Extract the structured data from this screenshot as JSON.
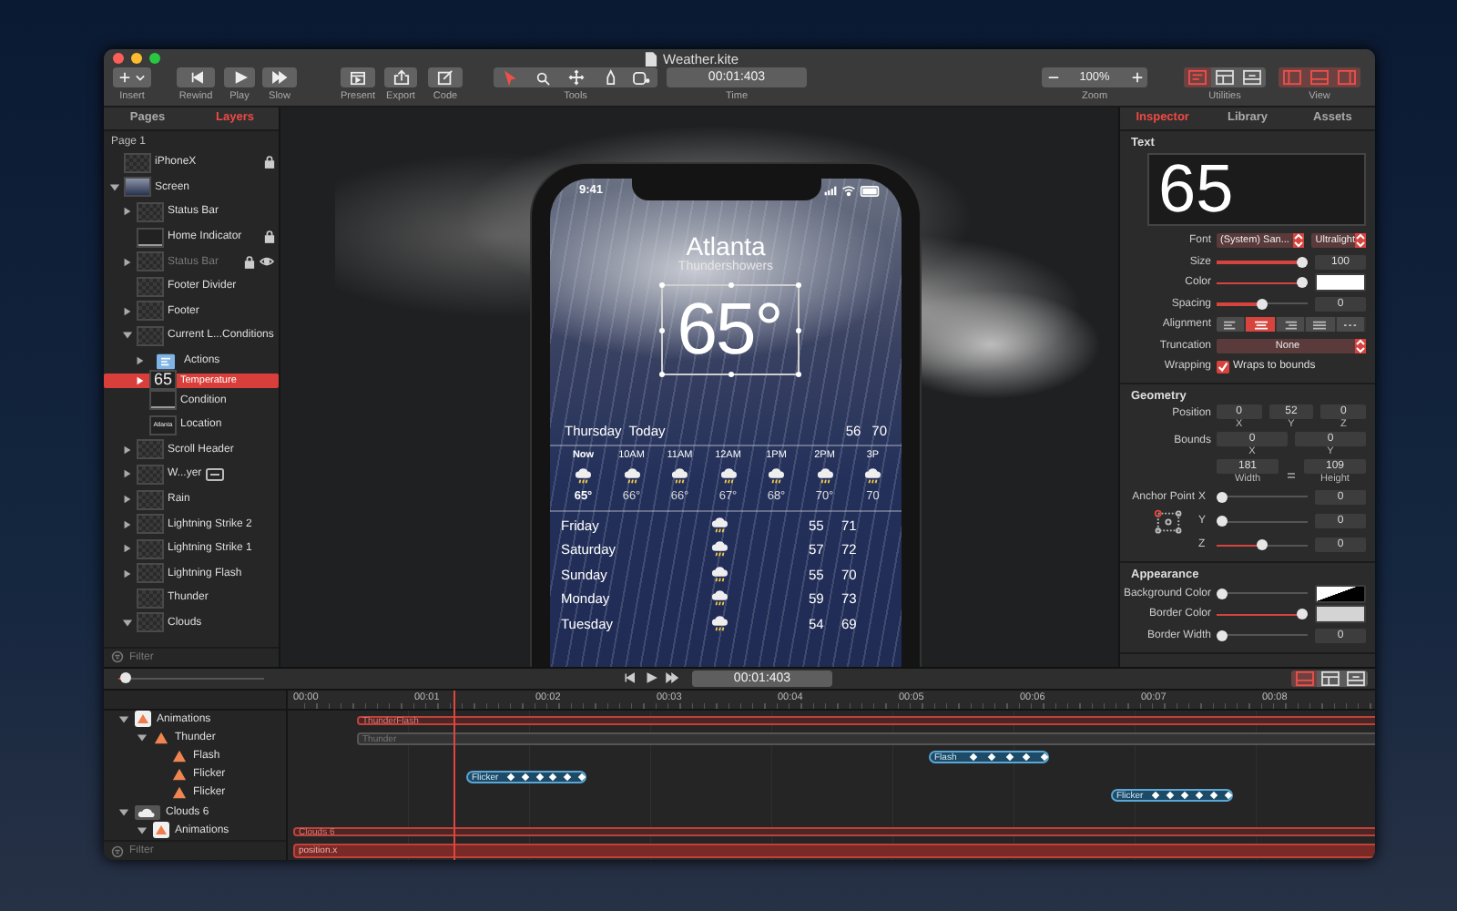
{
  "window": {
    "title": "Weather.kite"
  },
  "toolbar": [
    {
      "kind": "insert",
      "label": "Insert"
    },
    {
      "kind": "rewind",
      "label": "Rewind"
    },
    {
      "kind": "play",
      "label": "Play"
    },
    {
      "kind": "slow",
      "label": "Slow"
    },
    {
      "kind": "present",
      "label": "Present"
    },
    {
      "kind": "export",
      "label": "Export"
    },
    {
      "kind": "code",
      "label": "Code"
    },
    {
      "kind": "tools",
      "label": "Tools",
      "tools": [
        {
          "kind": "pointer",
          "selected": true
        },
        {
          "kind": "zoom",
          "selected": false
        },
        {
          "kind": "move",
          "selected": false
        },
        {
          "kind": "pen",
          "selected": false
        },
        {
          "kind": "shape",
          "selected": false
        }
      ]
    },
    {
      "kind": "time",
      "label": "Time",
      "value": "00:01:403"
    },
    {
      "kind": "zoom",
      "label": "Zoom",
      "value": "100%"
    },
    {
      "kind": "panes",
      "label": "Utilities",
      "panes": [
        {
          "kind": "inspector",
          "on": true
        },
        {
          "kind": "library",
          "on": false
        },
        {
          "kind": "assets",
          "on": false
        }
      ]
    },
    {
      "kind": "panes",
      "label": "View",
      "panes": [
        {
          "kind": "left",
          "on": true
        },
        {
          "kind": "bottom",
          "on": true
        },
        {
          "kind": "right",
          "on": true
        }
      ]
    }
  ],
  "layers_panel": {
    "tabs": [
      {
        "label": "Pages",
        "selected": false
      },
      {
        "label": "Layers",
        "selected": true
      }
    ],
    "page": "Page 1",
    "layers": [
      {
        "name": "iPhoneX",
        "locked": true,
        "hidden": false,
        "selected": false
      },
      {
        "name": "Screen",
        "expanded": true,
        "locked": false,
        "hidden": false,
        "selected": false,
        "children": [
          {
            "name": "Status Bar",
            "expanded": false,
            "locked": false,
            "hidden": false,
            "selected": false
          },
          {
            "name": "Home Indicator",
            "locked": true,
            "hidden": false,
            "selected": false
          },
          {
            "name": "Status Bar",
            "expanded": false,
            "locked": true,
            "hidden": true,
            "selected": false
          },
          {
            "name": "Footer Divider",
            "locked": false,
            "hidden": false,
            "selected": false
          },
          {
            "name": "Footer",
            "expanded": false,
            "locked": false,
            "hidden": false,
            "selected": false
          },
          {
            "name": "Current L...Conditions",
            "expanded": true,
            "locked": false,
            "hidden": false,
            "selected": false,
            "children": [
              {
                "name": "Actions",
                "expanded": false,
                "locked": false,
                "hidden": false,
                "selected": false
              },
              {
                "name": "Temperature",
                "thumb_text": "65",
                "expanded": false,
                "locked": false,
                "hidden": false,
                "selected": true
              },
              {
                "name": "Condition",
                "locked": false,
                "hidden": false,
                "selected": false
              },
              {
                "name": "Location",
                "thumb_text": "Atlanta",
                "locked": false,
                "hidden": false,
                "selected": false
              }
            ]
          },
          {
            "name": "Scroll Header",
            "expanded": false,
            "locked": false,
            "hidden": false,
            "selected": false
          },
          {
            "name": "W...yer",
            "badge": true,
            "expanded": false,
            "locked": false,
            "hidden": false,
            "selected": false
          },
          {
            "name": "Rain",
            "expanded": false,
            "locked": false,
            "hidden": false,
            "selected": false
          },
          {
            "name": "Lightning Strike 2",
            "expanded": false,
            "locked": false,
            "hidden": false,
            "selected": false
          },
          {
            "name": "Lightning Strike 1",
            "expanded": false,
            "locked": false,
            "hidden": false,
            "selected": false
          },
          {
            "name": "Lightning Flash",
            "expanded": false,
            "locked": false,
            "hidden": false,
            "selected": false
          },
          {
            "name": "Thunder",
            "locked": false,
            "hidden": false,
            "selected": false
          },
          {
            "name": "Clouds",
            "expanded": true,
            "locked": false,
            "hidden": false,
            "selected": false
          }
        ]
      }
    ],
    "filter": {
      "placeholder": "Filter"
    }
  },
  "phone": {
    "status_time": "9:41",
    "city": "Atlanta",
    "condition": "Thundershowers",
    "temperature": "65°",
    "today": {
      "day": "Thursday",
      "label": "Today",
      "low": "56",
      "high": "70"
    },
    "hourly": [
      {
        "time": "Now",
        "temp": "65°",
        "now": true
      },
      {
        "time": "10AM",
        "temp": "66°",
        "now": false
      },
      {
        "time": "11AM",
        "temp": "66°",
        "now": false
      },
      {
        "time": "12AM",
        "temp": "67°",
        "now": false
      },
      {
        "time": "1PM",
        "temp": "68°",
        "now": false
      },
      {
        "time": "2PM",
        "temp": "70°",
        "now": false
      },
      {
        "time": "3P",
        "temp": "70",
        "now": false
      }
    ],
    "daily": [
      {
        "day": "Friday",
        "low": "55",
        "high": "71"
      },
      {
        "day": "Saturday",
        "low": "57",
        "high": "72"
      },
      {
        "day": "Sunday",
        "low": "55",
        "high": "70"
      },
      {
        "day": "Monday",
        "low": "59",
        "high": "73"
      },
      {
        "day": "Tuesday",
        "low": "54",
        "high": "69"
      }
    ]
  },
  "inspector": {
    "tabs": [
      {
        "label": "Inspector",
        "selected": true
      },
      {
        "label": "Library",
        "selected": false
      },
      {
        "label": "Assets",
        "selected": false
      }
    ],
    "sections": [
      {
        "title": "Text",
        "rows": [
          {
            "kind": "preview",
            "value": "65"
          },
          {
            "kind": "font",
            "label": "Font",
            "family": "(System) San...",
            "weight": "Ultralight"
          },
          {
            "kind": "slider",
            "label": "Size",
            "level": 1,
            "value": "100"
          },
          {
            "kind": "color",
            "label": "Color",
            "level": 1,
            "color": "#ffffff"
          },
          {
            "kind": "slider",
            "label": "Spacing",
            "level": 0.5,
            "value": "0"
          },
          {
            "kind": "segmented",
            "label": "Alignment",
            "options": [
              {
                "kind": "left",
                "selected": false
              },
              {
                "kind": "center",
                "selected": true
              },
              {
                "kind": "right",
                "selected": false
              },
              {
                "kind": "justify",
                "selected": false
              },
              {
                "kind": "natural",
                "selected": false
              }
            ]
          },
          {
            "kind": "select",
            "label": "Truncation",
            "value": "None"
          },
          {
            "kind": "checkbox",
            "label": "Wrapping",
            "checked": true,
            "text": "Wraps to bounds"
          }
        ]
      },
      {
        "title": "Geometry",
        "rows": [
          {
            "kind": "fields",
            "label": "Position",
            "fields": [
              {
                "value": "0",
                "caption": "X"
              },
              {
                "value": "52",
                "caption": "Y"
              },
              {
                "value": "0",
                "caption": "Z"
              }
            ]
          },
          {
            "kind": "fields",
            "label": "Bounds",
            "fields": [
              {
                "value": "0",
                "caption": "X"
              },
              {
                "value": "0",
                "caption": "Y"
              }
            ]
          },
          {
            "kind": "fields",
            "linked": true,
            "fields": [
              {
                "value": "181",
                "caption": "Width"
              },
              {
                "value": "109",
                "caption": "Height"
              }
            ]
          },
          {
            "kind": "axis",
            "label": "Anchor Point",
            "axis": "X",
            "level": 0,
            "value": "0"
          },
          {
            "kind": "axis",
            "axis": "Y",
            "anchor": true,
            "level": 0,
            "value": "0"
          },
          {
            "kind": "axis",
            "axis": "Z",
            "level": 0.5,
            "value": "0"
          }
        ]
      },
      {
        "title": "Appearance",
        "rows": [
          {
            "kind": "color",
            "label": "Background Color",
            "level": 0
          },
          {
            "kind": "color",
            "label": "Border Color",
            "level": 1,
            "color": "#d4d4d4"
          },
          {
            "kind": "slider",
            "label": "Border Width",
            "level": 0,
            "value": "0"
          }
        ]
      }
    ]
  },
  "timeline": {
    "level": 0.02,
    "time": "00:01:403",
    "views": [
      {
        "kind": "bottom",
        "on": true
      },
      {
        "kind": "library",
        "on": false
      },
      {
        "kind": "assets",
        "on": false
      }
    ],
    "ruler": [
      "00:00",
      "00:01",
      "00:02",
      "00:03",
      "00:04",
      "00:05",
      "00:06",
      "00:07",
      "00:08"
    ],
    "tracks": [
      {
        "name": "Animations",
        "expanded": true,
        "clips": [
          {
            "label": "ThunderFlash",
            "kind": "group"
          }
        ],
        "children": [
          {
            "name": "Thunder",
            "expanded": true,
            "clips": [
              {
                "label": "Thunder",
                "kind": "layer"
              }
            ],
            "children": [
              {
                "name": "Flash",
                "clips": [
                  {
                    "label": "Flash",
                    "kind": "keyframes"
                  }
                ]
              },
              {
                "name": "Flicker",
                "clips": [
                  {
                    "label": "Flicker",
                    "kind": "keyframes"
                  }
                ]
              },
              {
                "name": "Flicker",
                "clips": [
                  {
                    "label": "Flicker",
                    "kind": "keyframes"
                  }
                ]
              }
            ]
          }
        ]
      },
      {
        "name": "Clouds 6",
        "expanded": true,
        "children": [
          {
            "name": "Animations",
            "expanded": true,
            "clips": [
              {
                "label": "Clouds 6",
                "kind": "group"
              },
              {
                "label": "position.x",
                "kind": "property"
              }
            ]
          }
        ]
      }
    ],
    "filter": {
      "placeholder": "Filter"
    }
  }
}
